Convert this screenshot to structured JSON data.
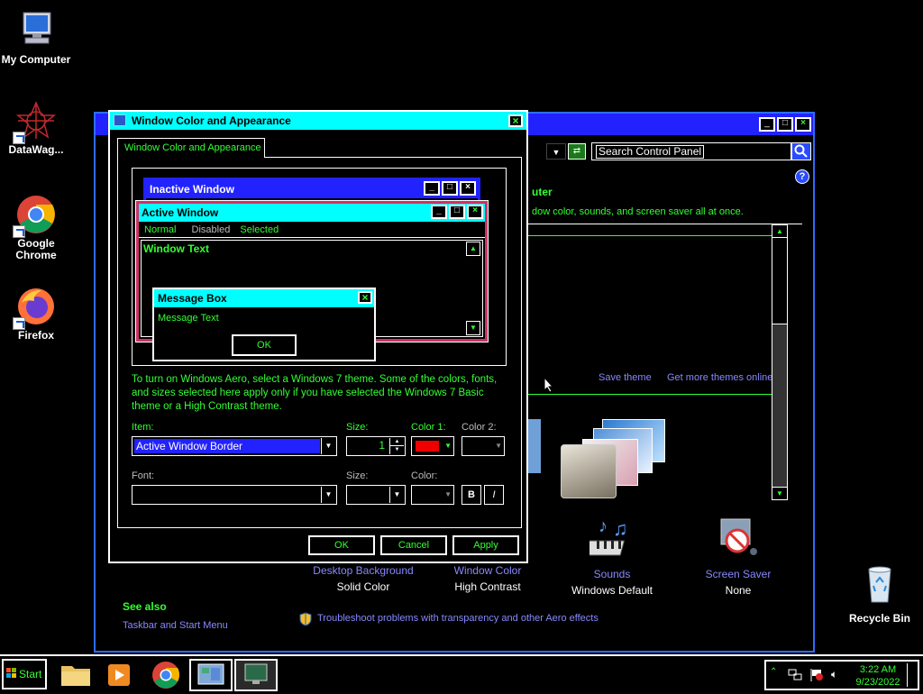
{
  "desktop": {
    "icons": [
      {
        "label": "My Computer"
      },
      {
        "label": "DataWag..."
      },
      {
        "label": "Google Chrome"
      },
      {
        "label": "Firefox"
      },
      {
        "label": "Recycle Bin"
      }
    ]
  },
  "control_panel": {
    "search_placeholder": "Search Control Panel",
    "heading_partial": "uter",
    "description_partial": "dow color, sounds, and screen saver all at once.",
    "save_theme": "Save theme",
    "more_themes": "Get more themes online",
    "tiles": [
      {
        "label": "Desktop Background",
        "value": "Solid Color"
      },
      {
        "label": "Window Color",
        "value": "High Contrast"
      },
      {
        "label": "Sounds",
        "value": "Windows Default"
      },
      {
        "label": "Screen Saver",
        "value": "None"
      }
    ],
    "see_also": "See also",
    "taskbar_link": "Taskbar and Start Menu",
    "troubleshoot": "Troubleshoot problems with transparency and other Aero effects"
  },
  "dialog": {
    "title": "Window Color and Appearance",
    "tab": "Window Color and Appearance",
    "preview": {
      "inactive_title": "Inactive Window",
      "active_title": "Active Window",
      "menu_normal": "Normal",
      "menu_disabled": "Disabled",
      "menu_selected": "Selected",
      "window_text": "Window Text",
      "msgbox_title": "Message Box",
      "msgbox_text": "Message Text",
      "msgbox_ok": "OK"
    },
    "info": "To turn on Windows Aero, select a Windows 7 theme.  Some of the colors, fonts, and sizes selected here apply only if you have selected the Windows 7 Basic theme or a High Contrast theme.",
    "item_label": "Item:",
    "item_value": "Active Window Border",
    "size_label": "Size:",
    "size_value": "1",
    "color1_label": "Color 1:",
    "color1_value": "#ee0000",
    "color2_label": "Color 2:",
    "font_label": "Font:",
    "font_size_label": "Size:",
    "font_color_label": "Color:",
    "bold": "B",
    "italic": "I",
    "ok": "OK",
    "cancel": "Cancel",
    "apply": "Apply"
  },
  "taskbar": {
    "start": "Start",
    "time": "3:22 AM",
    "date": "9/23/2022"
  }
}
